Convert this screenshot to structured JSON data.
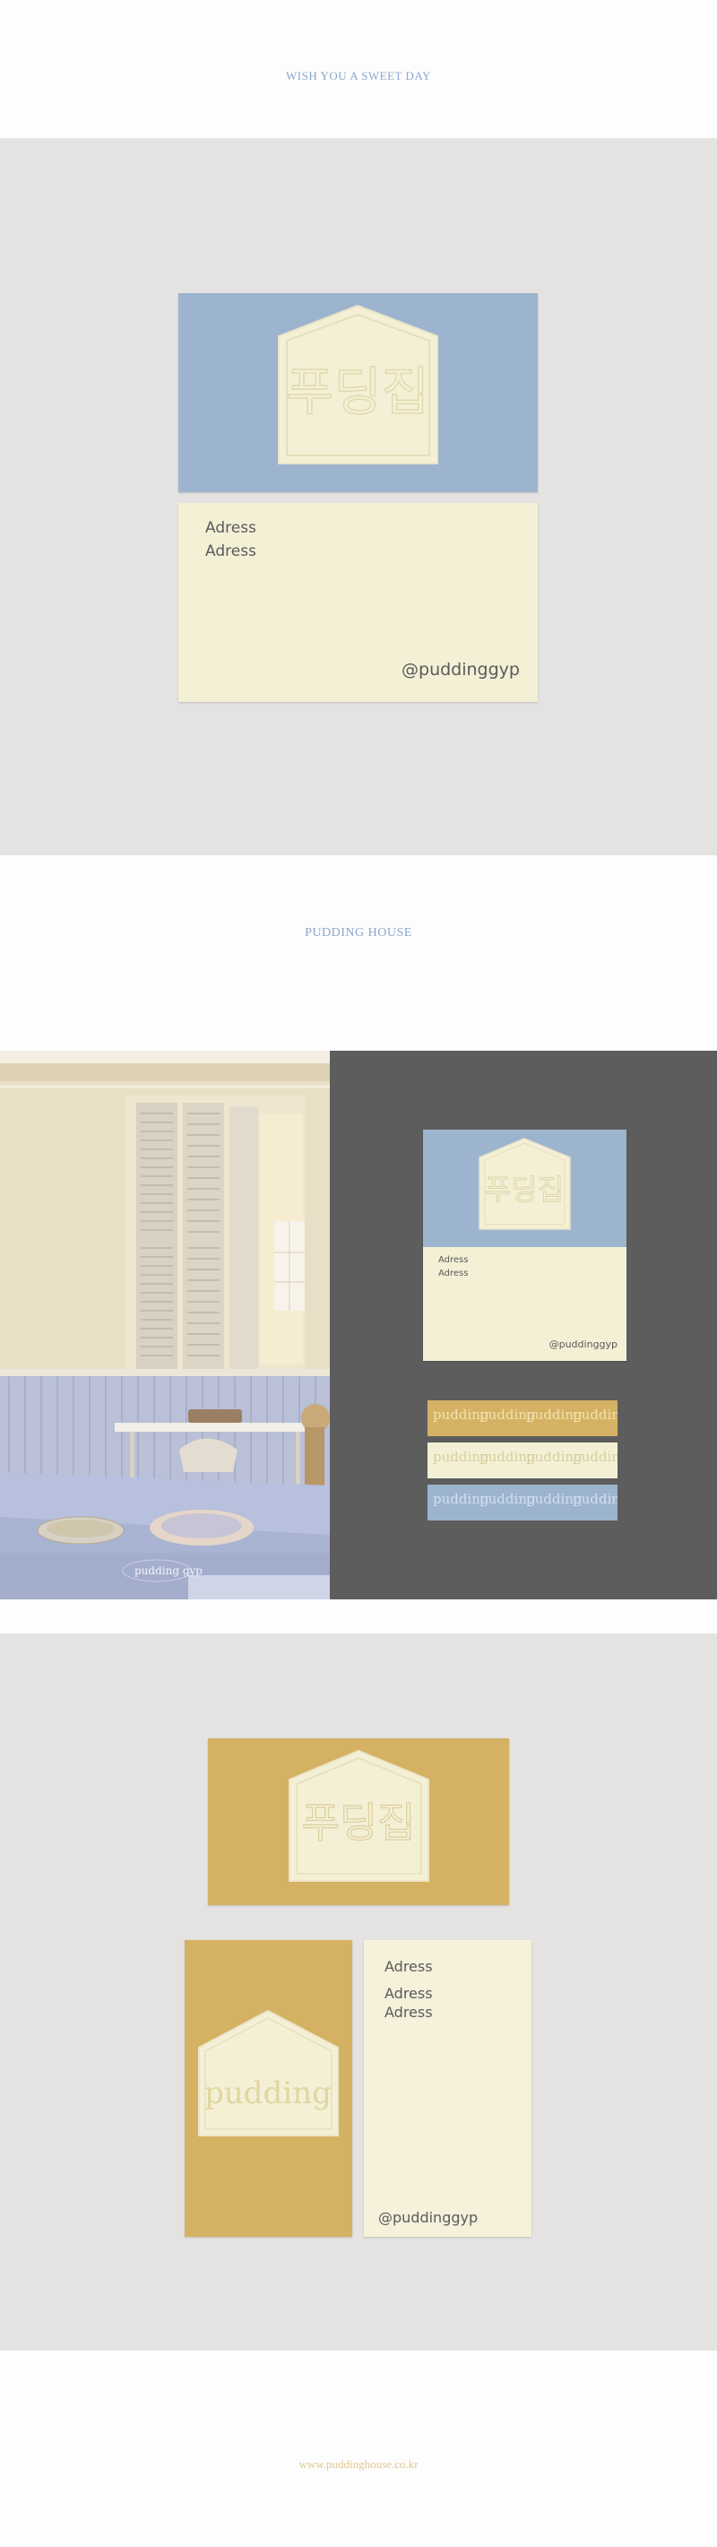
{
  "header": {
    "tagline": "WISH YOU A SWEET DAY"
  },
  "section1": {
    "logo_text": "푸딩집",
    "address_line_1": "Adress",
    "address_line_2": "Adress",
    "handle": "@puddinggyp"
  },
  "section2": {
    "title": "PUDDING HOUSE",
    "photo_stamp": "pudding gyp",
    "mini_card": {
      "logo_text": "푸딩집",
      "address_line_1": "Adress",
      "address_line_2": "Adress",
      "handle": "@puddinggyp"
    },
    "strip_word": "pudding",
    "strip_colors": [
      "#d5b263",
      "#f4f0d6",
      "#9db4cf"
    ]
  },
  "section3": {
    "logo_text": "푸딩집",
    "vertical_logo_text": "pudding",
    "address_line_1": "Adress",
    "address_line_2": "Adress",
    "address_line_3": "Adress",
    "handle": "@puddinggyp"
  },
  "footer": {
    "url": "www.puddinghouse.co.kr"
  },
  "colors": {
    "blue": "#9db4cf",
    "cream": "#f4f0d6",
    "mustard": "#d5b263",
    "gray_bg": "#e5e3e2",
    "dark_panel": "#5d5d5d"
  }
}
